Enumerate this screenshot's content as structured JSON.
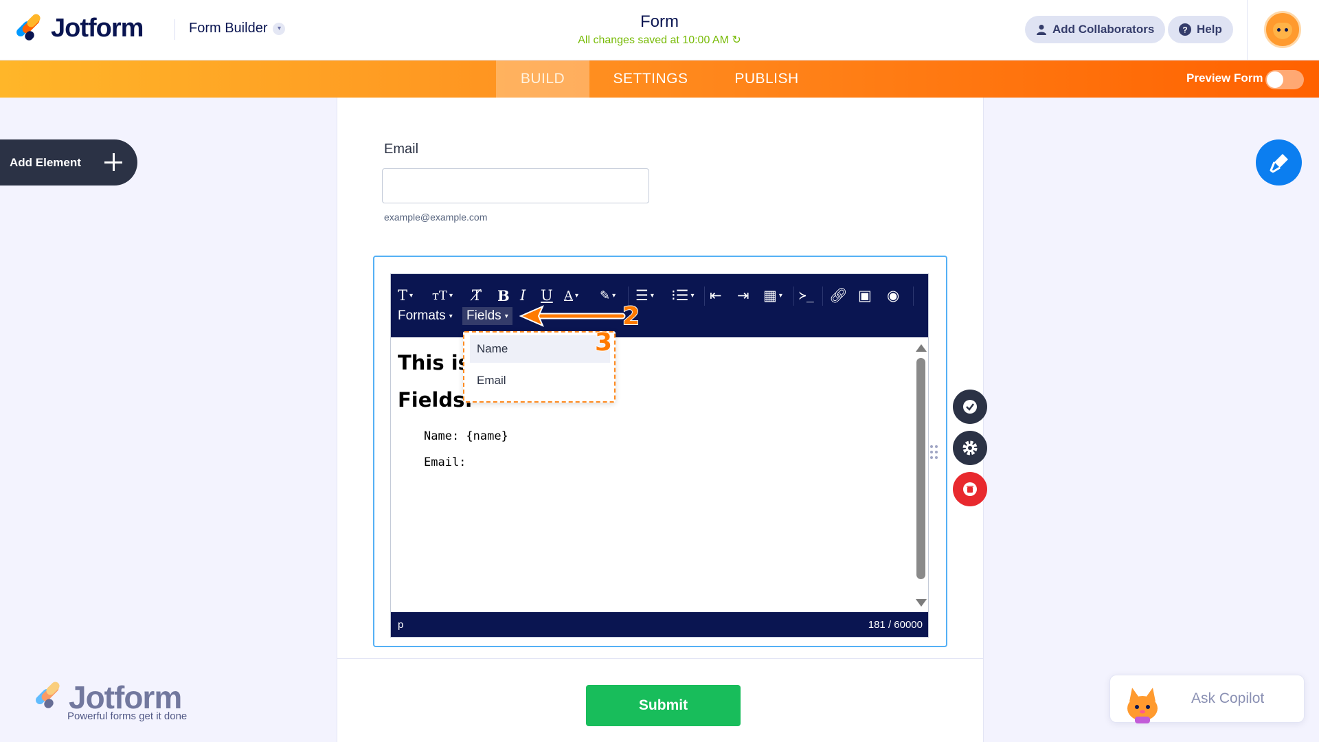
{
  "header": {
    "brand": "Jotform",
    "builder_label": "Form Builder",
    "form_title": "Form",
    "saved_status": "All changes saved at 10:00 AM",
    "add_collaborators": "Add Collaborators",
    "help": "Help"
  },
  "nav": {
    "tabs": [
      {
        "label": "BUILD",
        "active": true
      },
      {
        "label": "SETTINGS",
        "active": false
      },
      {
        "label": "PUBLISH",
        "active": false
      }
    ],
    "preview_label": "Preview Form"
  },
  "sidebar": {
    "add_element": "Add Element"
  },
  "form": {
    "email_label": "Email",
    "email_placeholder": "",
    "email_hint": "example@example.com",
    "submit": "Submit"
  },
  "editor": {
    "menus": {
      "formats": "Formats",
      "fields": "Fields"
    },
    "content": {
      "heading1": "This is",
      "heading2": "Fields:",
      "line1": "Name: {name}",
      "line2": "Email:"
    },
    "status_path": "p",
    "char_count": "181 / 60000"
  },
  "fields_dropdown": {
    "items": [
      "Name",
      "Email"
    ]
  },
  "annotations": {
    "step2": "2",
    "step3": "3"
  },
  "footer": {
    "brand": "Jotform",
    "tagline": "Powerful forms get it done",
    "copilot": "Ask Copilot"
  },
  "colors": {
    "navy": "#0a1551",
    "orange": "#ff6100",
    "green": "#18bd5b",
    "blue": "#0b7ef0",
    "red": "#e8292e"
  }
}
